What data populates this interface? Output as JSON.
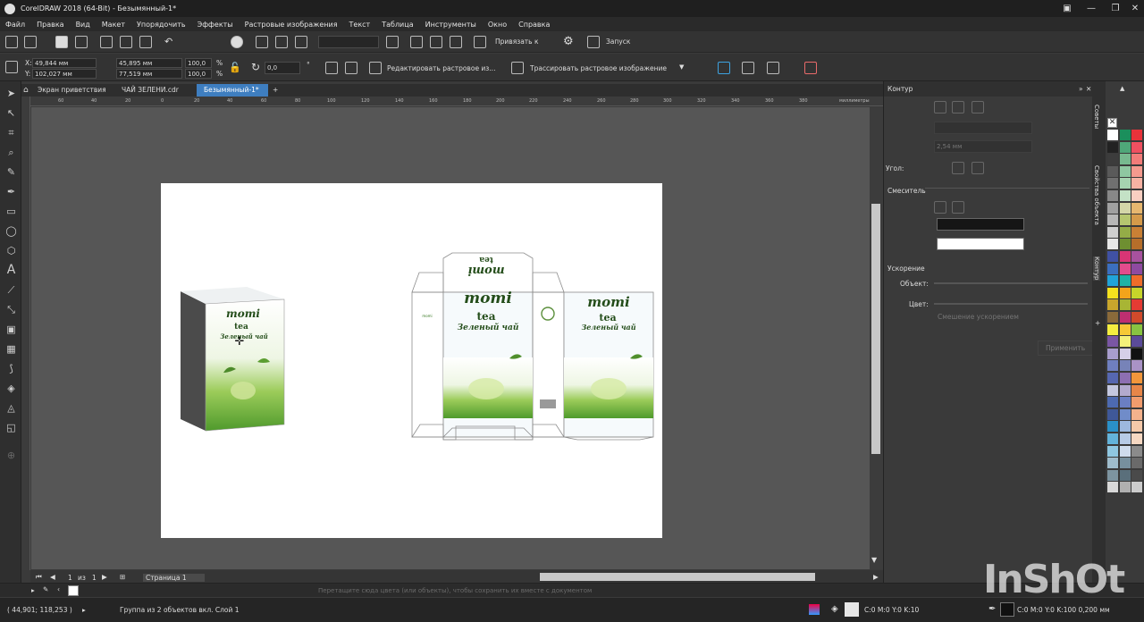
{
  "title": "CorelDRAW 2018 (64-Bit) - Безымянный-1*",
  "menu": [
    "Файл",
    "Правка",
    "Вид",
    "Макет",
    "Упорядочить",
    "Эффекты",
    "Растровые изображения",
    "Текст",
    "Таблица",
    "Инструменты",
    "Окно",
    "Справка"
  ],
  "toolbar": {
    "snap_label": "Привязать к",
    "launch_label": "Запуск"
  },
  "propbar": {
    "x": "49,844 мм",
    "y": "102,027 мм",
    "w": "45,895 мм",
    "h": "77,519 мм",
    "scale_x": "100,0",
    "scale_y": "100,0",
    "pct": "%",
    "angle": "0,0",
    "edit_bitmap": "Редактировать растровое из...",
    "trace_bitmap": "Трассировать растровое изображение"
  },
  "tabs": [
    "Экран приветствия",
    "ЧАЙ ЗЕЛЕНИ.cdr",
    "Безымянный-1*"
  ],
  "ruler_labels": [
    "60",
    "40",
    "20",
    "0",
    "20",
    "40",
    "60",
    "80",
    "100",
    "120",
    "140",
    "160",
    "180",
    "200",
    "220",
    "240",
    "260",
    "280",
    "300",
    "320",
    "340",
    "360",
    "380"
  ],
  "ruler_unit": "миллиметры",
  "artwork": {
    "brand": "momi",
    "tea": "tea",
    "subtitle": "Зеленый чай",
    "flipped_brand": "momi",
    "flipped_tea": "tea",
    "small_logo": "momi"
  },
  "page_nav": {
    "current": "1",
    "of": "из",
    "total": "1",
    "page_tab": "Страница 1"
  },
  "status": {
    "hint": "Перетащите сюда цвета (или объекты), чтобы сохранить их вместе с документом",
    "coords": "( 44,901; 118,253 )",
    "selection": "Группа из 2 объектов вкл. Слой 1",
    "fill_info": "C:0 M:0 Y:0 K:10",
    "outline_info": "C:0 M:0 Y:0 K:100  0,200 мм"
  },
  "panel": {
    "title": "Контур",
    "angle_label": "Угол:",
    "width_value": "2,54 мм",
    "mixer_label": "Смеситель",
    "accel_label": "Ускорение",
    "object_label": "Объект:",
    "color_label": "Цвет:",
    "blend_checkbox": "Смешение ускорением",
    "apply_button": "Применить"
  },
  "docker_tabs": [
    "Советы",
    "Свойства объекта",
    "Контур"
  ],
  "palette_colors": [
    "#ffffff",
    "#1b8f5c",
    "#e8333a",
    "#222222",
    "#4fa779",
    "#ef5060",
    "#3c3c3c",
    "#77b98f",
    "#f27c79",
    "#5a5a5a",
    "#8fc7a1",
    "#f59a8e",
    "#707070",
    "#a6d3b0",
    "#f7b2a3",
    "#888888",
    "#c4e2c6",
    "#f9cfc1",
    "#a0a0a0",
    "#d3d6a8",
    "#e7b76f",
    "#b7b7b7",
    "#b5c66f",
    "#d59a4a",
    "#cfcfcf",
    "#94ac47",
    "#c98035",
    "#e6e6e6",
    "#6e8f31",
    "#b66e2a",
    "#4051a3",
    "#d93575",
    "#a7529e",
    "#3b6fbf",
    "#e34c8d",
    "#8e4aa0",
    "#21a3d9",
    "#1eb2a6",
    "#ef6c2a",
    "#f5e11e",
    "#f3a41b",
    "#c7d42a",
    "#c9a62c",
    "#a8b534",
    "#e43b33",
    "#8a6a3a",
    "#be2f70",
    "#d14a2b",
    "#f4ed3f",
    "#f6c836",
    "#88c441",
    "#7a56a3",
    "#f4f07a",
    "#5b4b99",
    "#a89dcd",
    "#d6cfe8",
    "#111111",
    "#6f7fbf",
    "#7783b8",
    "#a993c6",
    "#5667b0",
    "#8d6fb1",
    "#f2963b",
    "#c4c8e0",
    "#b2aacd",
    "#e78648",
    "#4d6ab0",
    "#6b7fc2",
    "#f19c6d",
    "#3f5899",
    "#708cc9",
    "#f4b28c",
    "#2a90c8",
    "#9db8de",
    "#f5c9a9",
    "#63b3da",
    "#b7cbe6",
    "#f6d8c2",
    "#8fc7e1",
    "#cfdced",
    "#8b8b8b",
    "#9fbccc",
    "#77909e",
    "#6a6a6a",
    "#7d94a0",
    "#5a6f7b",
    "#4a4a4a",
    "#d8d8d8",
    "#b0b0b0",
    "#cccccc"
  ],
  "watermark": "InShOt"
}
